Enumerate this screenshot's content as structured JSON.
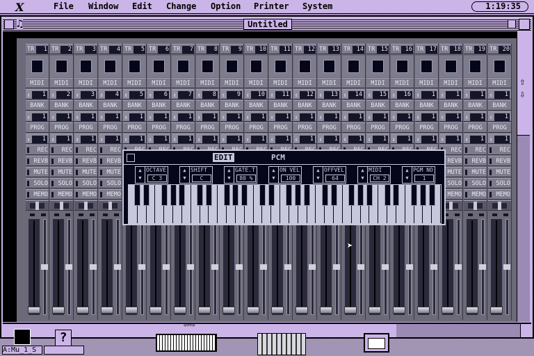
{
  "menubar": {
    "logo": "X",
    "items": [
      "File",
      "Window",
      "Edit",
      "Change",
      "Option",
      "Printer",
      "System"
    ],
    "clock": "1:19:35"
  },
  "window": {
    "title": "Untitled"
  },
  "tracks": {
    "prefix": "TR",
    "midi_label": "MIDI",
    "bank_label": "BANK",
    "prog_label": "PROG",
    "toggles": [
      "REC",
      "REVB",
      "MUTE",
      "SOLO",
      "MEMO"
    ],
    "numbers": [
      1,
      2,
      3,
      4,
      5,
      6,
      7,
      8,
      9,
      10,
      11,
      12,
      13,
      14,
      15,
      16,
      17,
      18,
      19,
      20
    ],
    "midi_channels": [
      1,
      2,
      3,
      4,
      5,
      6,
      7,
      8,
      9,
      10,
      11,
      12,
      13,
      14,
      15,
      16,
      1,
      1,
      1,
      1
    ],
    "banks": [
      1,
      1,
      1,
      1,
      1,
      1,
      1,
      1,
      1,
      1,
      1,
      1,
      1,
      1,
      1,
      1,
      1,
      1,
      1,
      1
    ],
    "programs": [
      1,
      1,
      1,
      1,
      1,
      1,
      1,
      1,
      1,
      1,
      1,
      1,
      1,
      1,
      1,
      1,
      1,
      1,
      1,
      1
    ],
    "pan_center": true,
    "fader_level": 0.0,
    "meter_level": 0.5
  },
  "edit_popup": {
    "edit_label": "EDIT",
    "title": "PCM",
    "params": [
      {
        "label": "OCTAVE",
        "value": "C 3"
      },
      {
        "label": "SHIFT",
        "value": "C"
      },
      {
        "label": "GATE.T",
        "value": "80 %"
      },
      {
        "label": "ON VEL",
        "value": "100"
      },
      {
        "label": "OFFVEL",
        "value": "64"
      },
      {
        "label": "MIDI",
        "value": "CH 2"
      },
      {
        "label": "PGM NO",
        "value": "1"
      }
    ]
  },
  "desktop": {
    "disk_label": "A:Mu_1_S",
    "help_icon": "?"
  },
  "colors": {
    "lavender": "#cbb4e8",
    "panel": "#6c6a78",
    "popup_bg": "#06061a"
  }
}
